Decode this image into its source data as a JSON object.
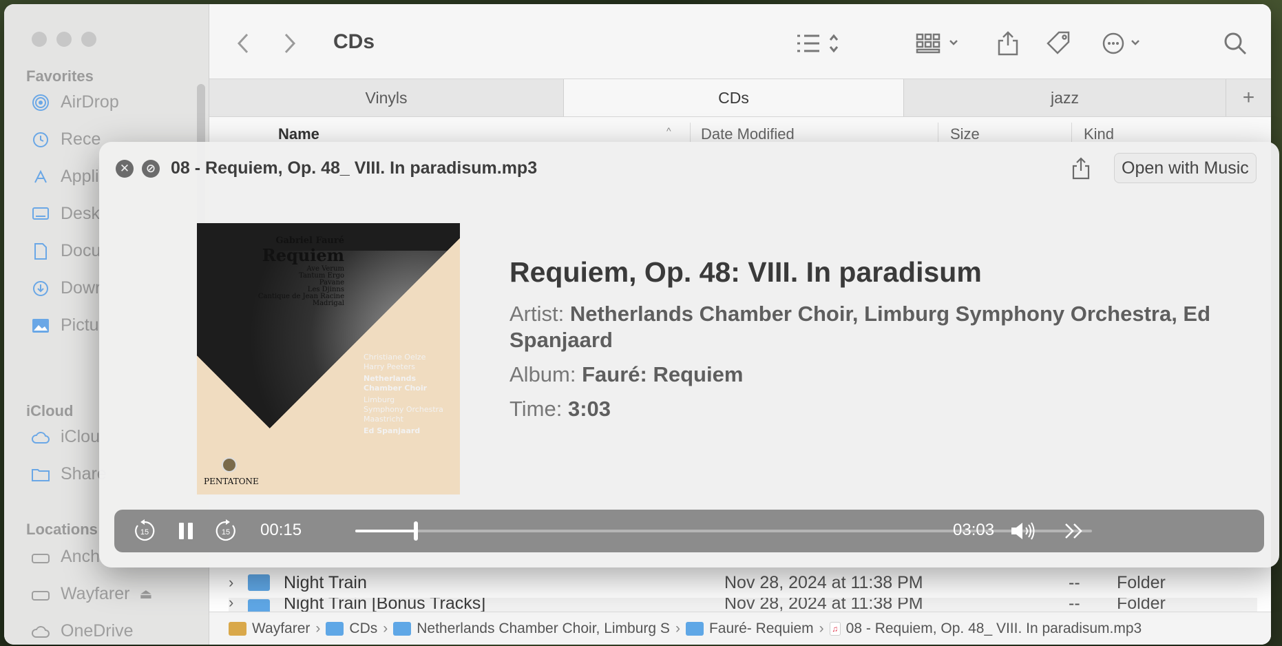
{
  "sidebar": {
    "favorites_label": "Favorites",
    "favorites": [
      "AirDrop",
      "Rece",
      "Appli",
      "Desk",
      "Docu",
      "Dowr",
      "Pictu"
    ],
    "icloud_label": "iCloud",
    "icloud": [
      "iClou",
      "Share"
    ],
    "locations_label": "Locations",
    "locations": [
      "Anch",
      "Wayfarer",
      "OneDrive"
    ]
  },
  "toolbar": {
    "title": "CDs"
  },
  "tabs": [
    "Vinyls",
    "CDs",
    "jazz"
  ],
  "columns": {
    "name": "Name",
    "date": "Date Modified",
    "size": "Size",
    "kind": "Kind"
  },
  "rows": [
    {
      "name": "Night Train",
      "date": "Nov 28, 2024 at 11:38 PM",
      "size": "--",
      "kind": "Folder"
    },
    {
      "name": "Night Train [Bonus Tracks]",
      "date": "Nov 28, 2024 at 11:38 PM",
      "size": "--",
      "kind": "Folder"
    }
  ],
  "pathbar": [
    "Wayfarer",
    "CDs",
    "Netherlands Chamber Choir, Limburg S",
    "Fauré- Requiem",
    "08 - Requiem, Op. 48_ VIII. In paradisum.mp3"
  ],
  "quicklook": {
    "filename": "08 - Requiem, Op. 48_ VIII. In paradisum.mp3",
    "open_button": "Open with Music",
    "track_title": "Requiem, Op. 48: VIII. In paradisum",
    "artist_label": "Artist:",
    "artist": "Netherlands Chamber Choir, Limburg Symphony Orchestra, Ed Spanjaard",
    "album_label": "Album:",
    "album": "Fauré: Requiem",
    "time_label": "Time:",
    "time": "3:03",
    "album_art": {
      "composer": "Gabriel Fauré",
      "work": "Requiem",
      "works": [
        "Ave Verum",
        "Tantum Ergo",
        "Pavane",
        "Les Djinns",
        "Cantique de Jean Racine",
        "Madrigal"
      ],
      "performers": [
        "Christiane Oelze",
        "Harry Peeters",
        "Netherlands",
        "Chamber Choir",
        "Limburg",
        "Symphony Orchestra",
        "Maastricht",
        "Ed Spanjaard"
      ],
      "label": "PENTATONE"
    }
  },
  "player": {
    "elapsed": "00:15",
    "duration": "03:03",
    "progress_fraction": 0.082,
    "skip_back": "15",
    "skip_forward": "15"
  }
}
